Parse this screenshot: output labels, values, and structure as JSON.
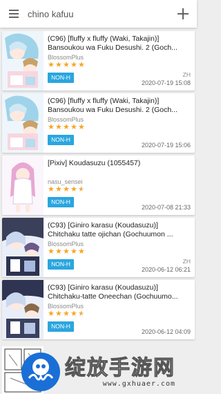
{
  "appbar": {
    "search_query": "chino kafuu"
  },
  "galleries": [
    {
      "title_line1": "(C96) [fluffy x fluffy (Waki, Takajin)]",
      "title_line2": "Bansoukou wa Fuku Desushi. 2 (Goch...",
      "uploader": "BlossomPlus",
      "rating": 5,
      "language": "ZH",
      "category": "NON-H",
      "date": "2020-07-19 15:08",
      "cover": "a"
    },
    {
      "title_line1": "(C96) [fluffy x fluffy (Waki, Takajin)]",
      "title_line2": "Bansoukou wa Fuku Desushi. 2 (Goch...",
      "uploader": "BlossomPlus",
      "rating": 5,
      "language": "",
      "category": "NON-H",
      "date": "2020-07-19 15:06",
      "cover": "a"
    },
    {
      "title_line1": "[Pixiv] Koudasuzu (1055457)",
      "title_line2": "",
      "uploader": "nasu_sensei",
      "rating": 4.5,
      "language": "",
      "category": "NON-H",
      "date": "2020-07-08 21:33",
      "cover": "b"
    },
    {
      "title_line1": "(C93) [Giniro karasu (Koudasuzu)]",
      "title_line2": "Chitchaku tatte ojichan (Gochuumon ...",
      "uploader": "BlossomPlus",
      "rating": 5,
      "language": "ZH",
      "category": "NON-H",
      "date": "2020-06-12 06:21",
      "cover": "c"
    },
    {
      "title_line1": "(C93) [Giniro karasu (Koudasuzu)]",
      "title_line2": "Chitchaku-tatte Oneechan (Gochuumo...",
      "uploader": "BlossomPlus",
      "rating": 4.5,
      "language": "",
      "category": "NON-H",
      "date": "2020-06-12 04:09",
      "cover": "c"
    }
  ],
  "watermark": {
    "brand_cn": "绽放手游网",
    "url": "www.gxhuaer.com"
  },
  "colors": {
    "badge": "#2aa6de",
    "star": "#f5a623",
    "appbar": "#ffffff",
    "background": "#eeeeee"
  },
  "icons": {
    "menu": "menu-icon",
    "add": "add-icon"
  }
}
